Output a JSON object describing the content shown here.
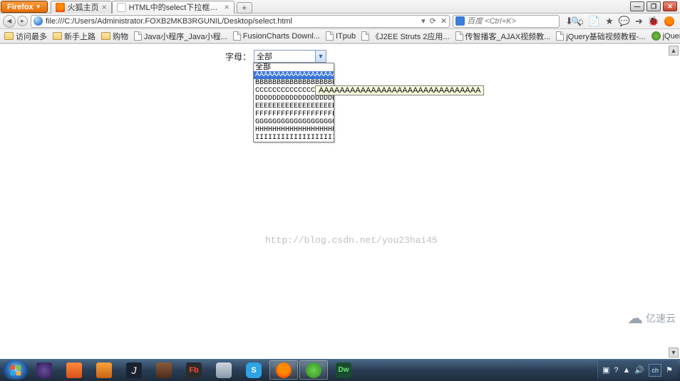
{
  "window": {
    "firefox_button": "Firefox",
    "tabs": [
      {
        "label": "火狐主页",
        "favicon": "firefox",
        "active": false
      },
      {
        "label": "HTML中的select下拉框内容显示不...",
        "favicon": "blank",
        "active": true
      }
    ],
    "new_tab": "+",
    "controls": {
      "min": "—",
      "max": "❐",
      "close": "✕"
    }
  },
  "navbar": {
    "url": "file:///C:/Users/Administrator.FOXB2MKB3RGUNIL/Desktop/select.html",
    "search_placeholder": "百度 <Ctrl+K>",
    "back": "◄",
    "fwd_small": "▸",
    "url_icons": {
      "dropdown": "▾",
      "reload": "⟳",
      "stop": "✕"
    },
    "search_go": "🔍",
    "tools": [
      "⬇",
      "⌂",
      "📄",
      "★",
      "💬",
      "➜",
      "🐞"
    ]
  },
  "bookmarks_bar": {
    "label_most": "访问最多",
    "items": [
      {
        "icon": "folder",
        "label": "新手上路"
      },
      {
        "icon": "folder",
        "label": "购物"
      },
      {
        "icon": "page",
        "label": "Java小程序_Java小程..."
      },
      {
        "icon": "page",
        "label": "FusionCharts Downl..."
      },
      {
        "icon": "page",
        "label": "ITpub"
      },
      {
        "icon": "page",
        "label": "《J2EE Struts 2应用..."
      },
      {
        "icon": "page",
        "label": "传智播客_AJAX视频教..."
      },
      {
        "icon": "page",
        "label": "jQuery基础视频教程-..."
      },
      {
        "icon": "jq",
        "label": "jQuery_ The Write L..."
      }
    ],
    "more": "»"
  },
  "page": {
    "field_label": "字母：",
    "selected": "全部",
    "options": [
      "全部",
      "AAAAAAAAAAAAAAAAAAAAAAAAAAAAAAA",
      "BBBBBBBBBBBBBBBBBBBBBBBBBBB",
      "CCCCCCCCCCCCCCCCCCCCCCCCCCCCC",
      "DDDDDDDDDDDDDDDDDDDDDDDDDDDDD",
      "EEEEEEEEEEEEEEEEEEEEEEEEEEEEEE",
      "FFFFFFFFFFFFFFFFFFFFFFFFFFF",
      "GGGGGGGGGGGGGGGGGGGGGGGGGGG",
      "HHHHHHHHHHHHHHHHHHHHHHHHHHHHH",
      "IIIIIIIIIIIIIIIIIIIIIIIIIIII"
    ],
    "highlight_index": 1,
    "tooltip": "AAAAAAAAAAAAAAAAAAAAAAAAAAAAAAA",
    "watermark": "http://blog.csdn.net/you23hai45",
    "brand": "亿速云"
  },
  "taskbar": {
    "apps": [
      "start",
      "eclipse",
      "plsql",
      "matlab",
      "java",
      "db",
      "flash",
      "cube",
      "skype",
      "firefox",
      "ie",
      "dreamweaver"
    ],
    "active_app": "firefox",
    "tray": {
      "lang": "ch",
      "icons": [
        "▣",
        "?",
        "▲",
        "🔊",
        "⚑"
      ]
    }
  }
}
